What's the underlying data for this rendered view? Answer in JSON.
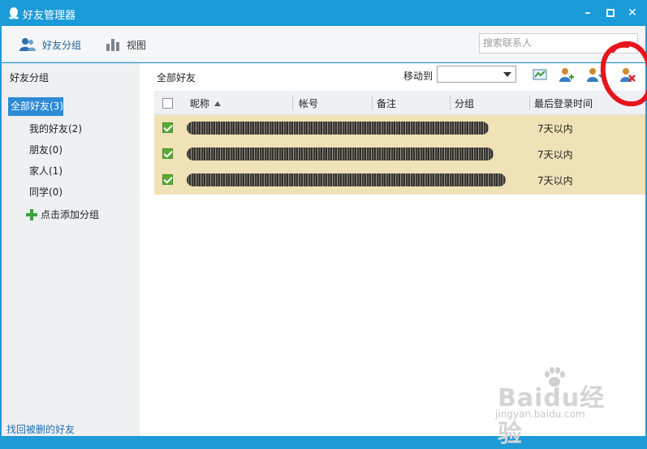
{
  "window": {
    "title": "好友管理器"
  },
  "toolbar": {
    "friend_groups_label": "好友分组",
    "view_label": "视图",
    "search_placeholder": "搜索联系人"
  },
  "sidebar": {
    "header": "好友分组",
    "selected": "全部好友(3)",
    "groups": [
      {
        "label": "我的好友(2)"
      },
      {
        "label": "朋友(0)"
      },
      {
        "label": "家人(1)"
      },
      {
        "label": "同学(0)"
      }
    ],
    "add_group_label": "点击添加分组",
    "recover_link": "找回被删的好友"
  },
  "main": {
    "current_group": "全部好友",
    "move_to_label": "移动到",
    "columns": {
      "nickname": "昵称",
      "account": "帐号",
      "remark": "备注",
      "group": "分组",
      "last_login": "最后登录时间"
    },
    "rows": [
      {
        "last_login": "7天以内",
        "checked": true
      },
      {
        "last_login": "7天以内",
        "checked": true
      },
      {
        "last_login": "7天以内",
        "checked": true
      }
    ]
  },
  "watermark": {
    "brand": "Baidu经验",
    "url": "jingyan.baidu.com"
  },
  "colors": {
    "titlebar": "#1b9bd7",
    "selected_group": "#2d8ad6",
    "selected_rows": "#efe2b6",
    "annotation": "#e8141c"
  }
}
